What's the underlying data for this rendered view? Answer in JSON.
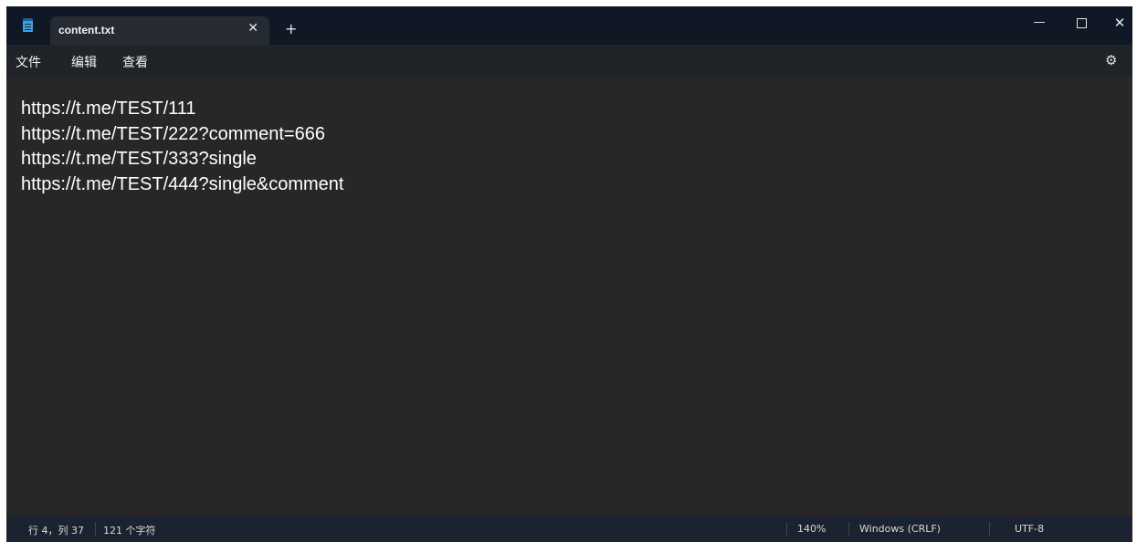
{
  "window": {
    "tab_title": "content.txt",
    "tab_close": "✕",
    "new_tab": "+",
    "minimize": "—",
    "close": "✕"
  },
  "menu": {
    "file": "文件",
    "edit": "编辑",
    "view": "查看",
    "settings_icon": "⚙"
  },
  "editor": {
    "lines": [
      "https://t.me/TEST/111",
      "https://t.me/TEST/222?comment=666",
      "https://t.me/TEST/333?single",
      "https://t.me/TEST/444?single&comment"
    ]
  },
  "status": {
    "position": "行 4，列 37",
    "char_count": "121 个字符",
    "zoom": "140%",
    "line_ending": "Windows (CRLF)",
    "encoding": "UTF-8"
  },
  "icons": {
    "app": "notepad-icon",
    "settings": "gear-icon"
  },
  "colors": {
    "titlebar": "#101725",
    "menubar": "#202327",
    "editor_bg": "#272727",
    "statusbar": "#1b2330",
    "app_icon": "#3aa0e6"
  }
}
